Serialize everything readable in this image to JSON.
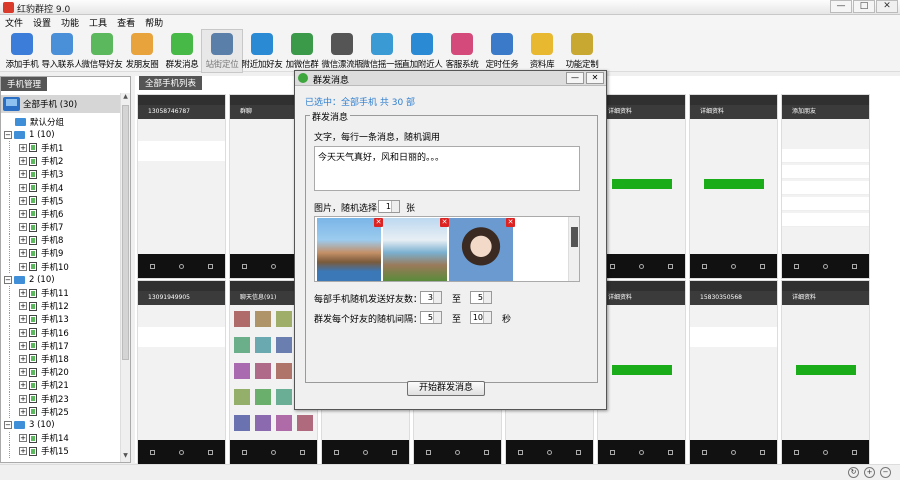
{
  "window": {
    "title": "红豹群控 9.0",
    "min": "—",
    "max": "□",
    "close": "✕"
  },
  "menu": [
    "文件",
    "设置",
    "功能",
    "工具",
    "查看",
    "帮助"
  ],
  "toolbar": [
    {
      "label": "添加手机",
      "icon": "add-phone-icon",
      "color": "#3b7dd8"
    },
    {
      "label": "导入联系人",
      "icon": "contact-icon",
      "color": "#4a90d9"
    },
    {
      "label": "微信导好友",
      "icon": "wechat-import-icon",
      "color": "#5cb85c"
    },
    {
      "label": "发朋友圈",
      "icon": "moments-icon",
      "color": "#e8a33d"
    },
    {
      "label": "群发消息",
      "icon": "wechat-icon",
      "color": "#46b946"
    },
    {
      "label": "站街定位",
      "icon": "pin-icon",
      "color": "#5a7fa8"
    },
    {
      "label": "附近加好友",
      "icon": "people-icon",
      "color": "#2a8ad4"
    },
    {
      "label": "加微信群",
      "icon": "qrcode-icon",
      "color": "#3a9a4a"
    },
    {
      "label": "微信漂流瓶",
      "icon": "bottle-icon",
      "color": "#555555"
    },
    {
      "label": "微信摇一摇",
      "icon": "shake-icon",
      "color": "#3a9ad4"
    },
    {
      "label": "直加附近人",
      "icon": "nearby-icon",
      "color": "#2a8ad4"
    },
    {
      "label": "客服系统",
      "icon": "service-icon",
      "color": "#d44a7a"
    },
    {
      "label": "定时任务",
      "icon": "clock-icon",
      "color": "#3a7ac8"
    },
    {
      "label": "资料库",
      "icon": "database-icon",
      "color": "#e8b830"
    },
    {
      "label": "功能定制",
      "icon": "code-icon",
      "color": "#c8a830"
    }
  ],
  "left": {
    "tab": "手机管理",
    "root": "全部手机 (30)",
    "default_group": "默认分组",
    "groups": [
      {
        "label": "1 (10)",
        "phones": [
          "手机1",
          "手机2",
          "手机3",
          "手机4",
          "手机5",
          "手机6",
          "手机7",
          "手机8",
          "手机9",
          "手机10"
        ]
      },
      {
        "label": "2 (10)",
        "phones": [
          "手机11",
          "手机12",
          "手机13",
          "手机16",
          "手机17",
          "手机18",
          "手机20",
          "手机21",
          "手机23",
          "手机25"
        ]
      },
      {
        "label": "3 (10)",
        "phones": [
          "手机14",
          "手机15"
        ]
      }
    ]
  },
  "right": {
    "tab": "全部手机列表"
  },
  "dialog": {
    "title": "群发消息",
    "selected": "已选中：全部手机 共 30 部",
    "group_label": "群发消息",
    "text_label": "文字，每行一条消息，随机调用",
    "text_value": "今天天气真好，风和日丽的。。。",
    "image_label": "图片，随机选择",
    "image_count": "1",
    "image_unit": "张",
    "friends_label": "每部手机随机发送好友数：",
    "friends_min": "3",
    "friends_max": "5",
    "to1": "至",
    "interval_label": "群发每个好友的随机间隔：",
    "interval_min": "5",
    "interval_max": "10",
    "to2": "至",
    "interval_unit": "秒",
    "start_button": "开始群发消息",
    "min": "—",
    "close": "✕"
  },
  "phones": [
    {
      "id": "手机1",
      "header": "13058746787",
      "screen": "search"
    },
    {
      "id": "手机2",
      "header": "群聊",
      "screen": "chat"
    },
    {
      "id": "手机3",
      "header": "详细资料",
      "screen": "profile"
    },
    {
      "id": "手机4",
      "header": "详细资料",
      "screen": "profile"
    },
    {
      "id": "手机5",
      "header": "详细资料",
      "screen": "profile"
    },
    {
      "id": "手机6",
      "header": "添加朋友",
      "screen": "add"
    },
    {
      "id": "手机7",
      "header": "13091949905",
      "screen": "search"
    },
    {
      "id": "手机8",
      "header": "聊天信息(91)",
      "screen": "grid"
    },
    {
      "id": "手机9",
      "header": "详细资料",
      "screen": "profile"
    },
    {
      "id": "手机10",
      "header": "15830350568",
      "screen": "search"
    },
    {
      "id": "手机11",
      "header": "详细资料",
      "screen": "profile"
    }
  ]
}
